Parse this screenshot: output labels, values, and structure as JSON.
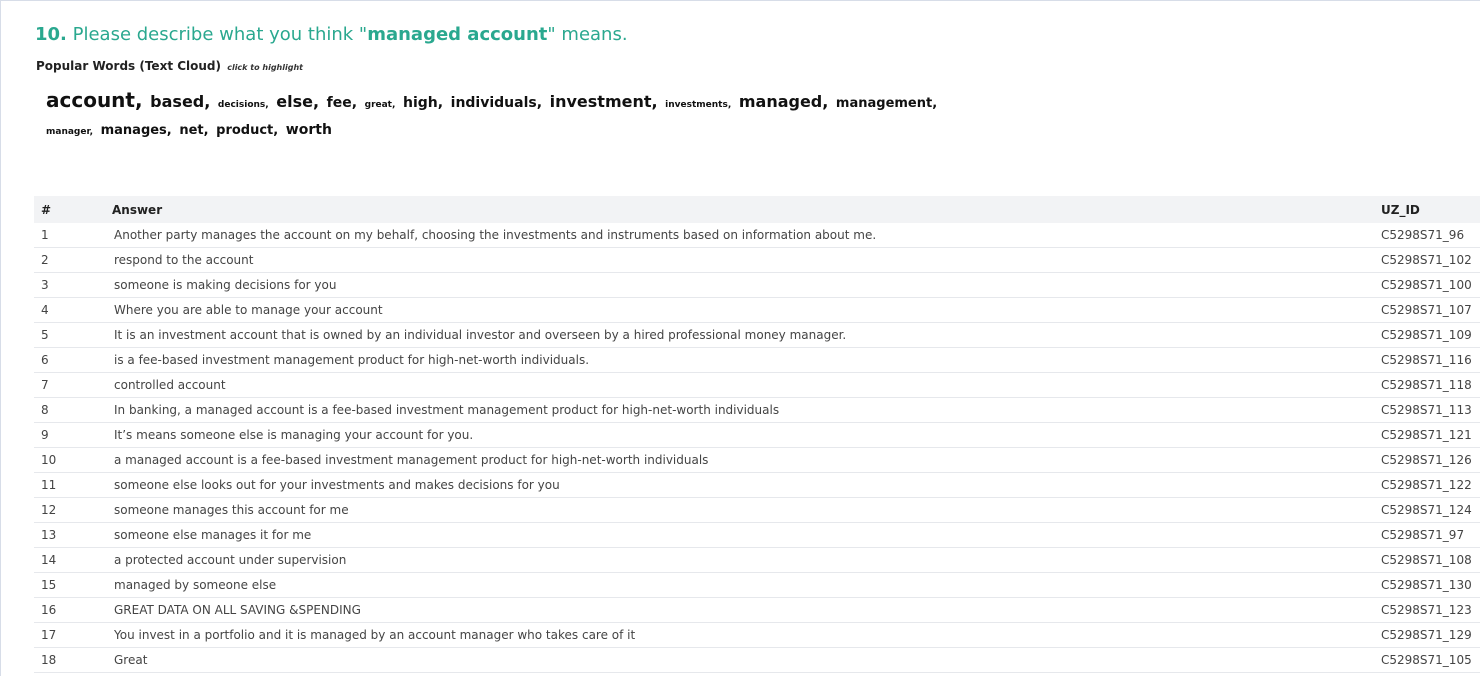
{
  "question": {
    "number": "10.",
    "prefix": "Please describe what you think \"",
    "term": "managed account",
    "suffix": "\" means."
  },
  "cloud": {
    "title": "Popular Words (Text Cloud)",
    "hint": "click to highlight",
    "words": [
      {
        "text": "account,",
        "size": "xl"
      },
      {
        "text": "based,",
        "size": "l"
      },
      {
        "text": "decisions,",
        "size": "xs"
      },
      {
        "text": "else,",
        "size": "l"
      },
      {
        "text": "fee,",
        "size": "m"
      },
      {
        "text": "great,",
        "size": "xs"
      },
      {
        "text": "high,",
        "size": "m"
      },
      {
        "text": "individuals,",
        "size": "m"
      },
      {
        "text": "investment,",
        "size": "l"
      },
      {
        "text": "investments,",
        "size": "xs"
      },
      {
        "text": "managed,",
        "size": "l"
      },
      {
        "text": "management,",
        "size": "s"
      },
      {
        "text": "manager,",
        "size": "xs"
      },
      {
        "text": "manages,",
        "size": "s"
      },
      {
        "text": "net,",
        "size": "s"
      },
      {
        "text": "product,",
        "size": "s"
      },
      {
        "text": "worth",
        "size": "m"
      }
    ]
  },
  "table": {
    "headers": {
      "num": "#",
      "answer": "Answer",
      "id": "UZ_ID"
    },
    "rows": [
      {
        "num": "1",
        "answer": "Another party manages the account on my behalf, choosing the investments and instruments based on information about me.",
        "id": "C5298S71_96"
      },
      {
        "num": "2",
        "answer": "respond to the account",
        "id": "C5298S71_102"
      },
      {
        "num": "3",
        "answer": "someone is making decisions for you",
        "id": "C5298S71_100"
      },
      {
        "num": "4",
        "answer": "Where you are able to manage your account",
        "id": "C5298S71_107"
      },
      {
        "num": "5",
        "answer": "It is an investment account that is owned by an individual investor and overseen by a hired professional money manager.",
        "id": "C5298S71_109"
      },
      {
        "num": "6",
        "answer": "is a fee-based investment management product for high-net-worth individuals.",
        "id": "C5298S71_116"
      },
      {
        "num": "7",
        "answer": "controlled account",
        "id": "C5298S71_118"
      },
      {
        "num": "8",
        "answer": "In banking, a managed account is a fee-based investment management product for high-net-worth individuals",
        "id": "C5298S71_113"
      },
      {
        "num": "9",
        "answer": "It’s means someone else is managing your account for you.",
        "id": "C5298S71_121"
      },
      {
        "num": "10",
        "answer": "a managed account is a fee-based investment management product for high-net-worth individuals",
        "id": "C5298S71_126"
      },
      {
        "num": "11",
        "answer": "someone else looks out for your investments and makes decisions for you",
        "id": "C5298S71_122"
      },
      {
        "num": "12",
        "answer": "someone manages this account for me",
        "id": "C5298S71_124"
      },
      {
        "num": "13",
        "answer": "someone else manages it for me",
        "id": "C5298S71_97"
      },
      {
        "num": "14",
        "answer": "a protected account under supervision",
        "id": "C5298S71_108"
      },
      {
        "num": "15",
        "answer": "managed by someone else",
        "id": "C5298S71_130"
      },
      {
        "num": "16",
        "answer": "GREAT DATA ON ALL SAVING &SPENDING",
        "id": "C5298S71_123"
      },
      {
        "num": "17",
        "answer": "You invest in a portfolio and it is managed by an account manager who takes care of it",
        "id": "C5298S71_129"
      },
      {
        "num": "18",
        "answer": "Great",
        "id": "C5298S71_105"
      }
    ]
  }
}
